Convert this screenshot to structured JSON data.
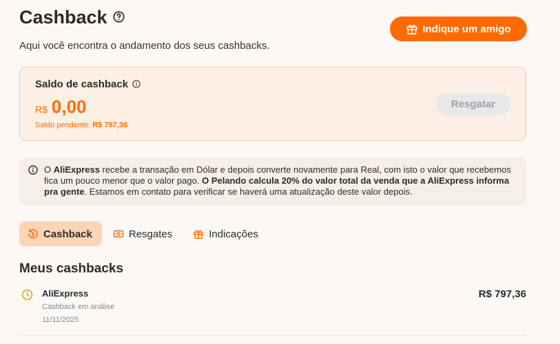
{
  "header": {
    "title": "Cashback",
    "subtitle": "Aqui você encontra o andamento dos seus cashbacks.",
    "invite_label": "Indique um amigo"
  },
  "balance": {
    "title": "Saldo de cashback",
    "currency": "R$",
    "amount": "0,00",
    "pending_label": "Saldo pendente:",
    "pending_value": "R$ 797,36",
    "redeem_label": "Resgatar"
  },
  "notice": {
    "part1": "O ",
    "part2": "AliExpress",
    "part3": " recebe a transação em Dólar e depois converte novamente para Real, com isto o valor que recebemos fica um pouco menor que o valor pago. ",
    "part4": "O Pelando calcula 20% do valor total da venda que a AliExpress informa pra gente",
    "part5": ". Estamos em contato para verificar se haverá uma atualização deste valor depois."
  },
  "tabs": [
    {
      "label": "Cashback",
      "icon": "cashback-icon",
      "active": true
    },
    {
      "label": "Resgates",
      "icon": "money-icon",
      "active": false
    },
    {
      "label": "Indicações",
      "icon": "gift-icon",
      "active": false
    }
  ],
  "section": {
    "title": "Meus cashbacks"
  },
  "cashbacks": [
    {
      "merchant": "AliExpress",
      "status": "Cashback em análise",
      "date": "11/11/2025",
      "value": "R$ 797,36",
      "icon": "clock-icon"
    }
  ],
  "colors": {
    "accent": "#ff6b00",
    "card_bg": "#fcefe3",
    "tab_active_bg": "#fcd5b4",
    "pending_icon": "#d9a400"
  }
}
